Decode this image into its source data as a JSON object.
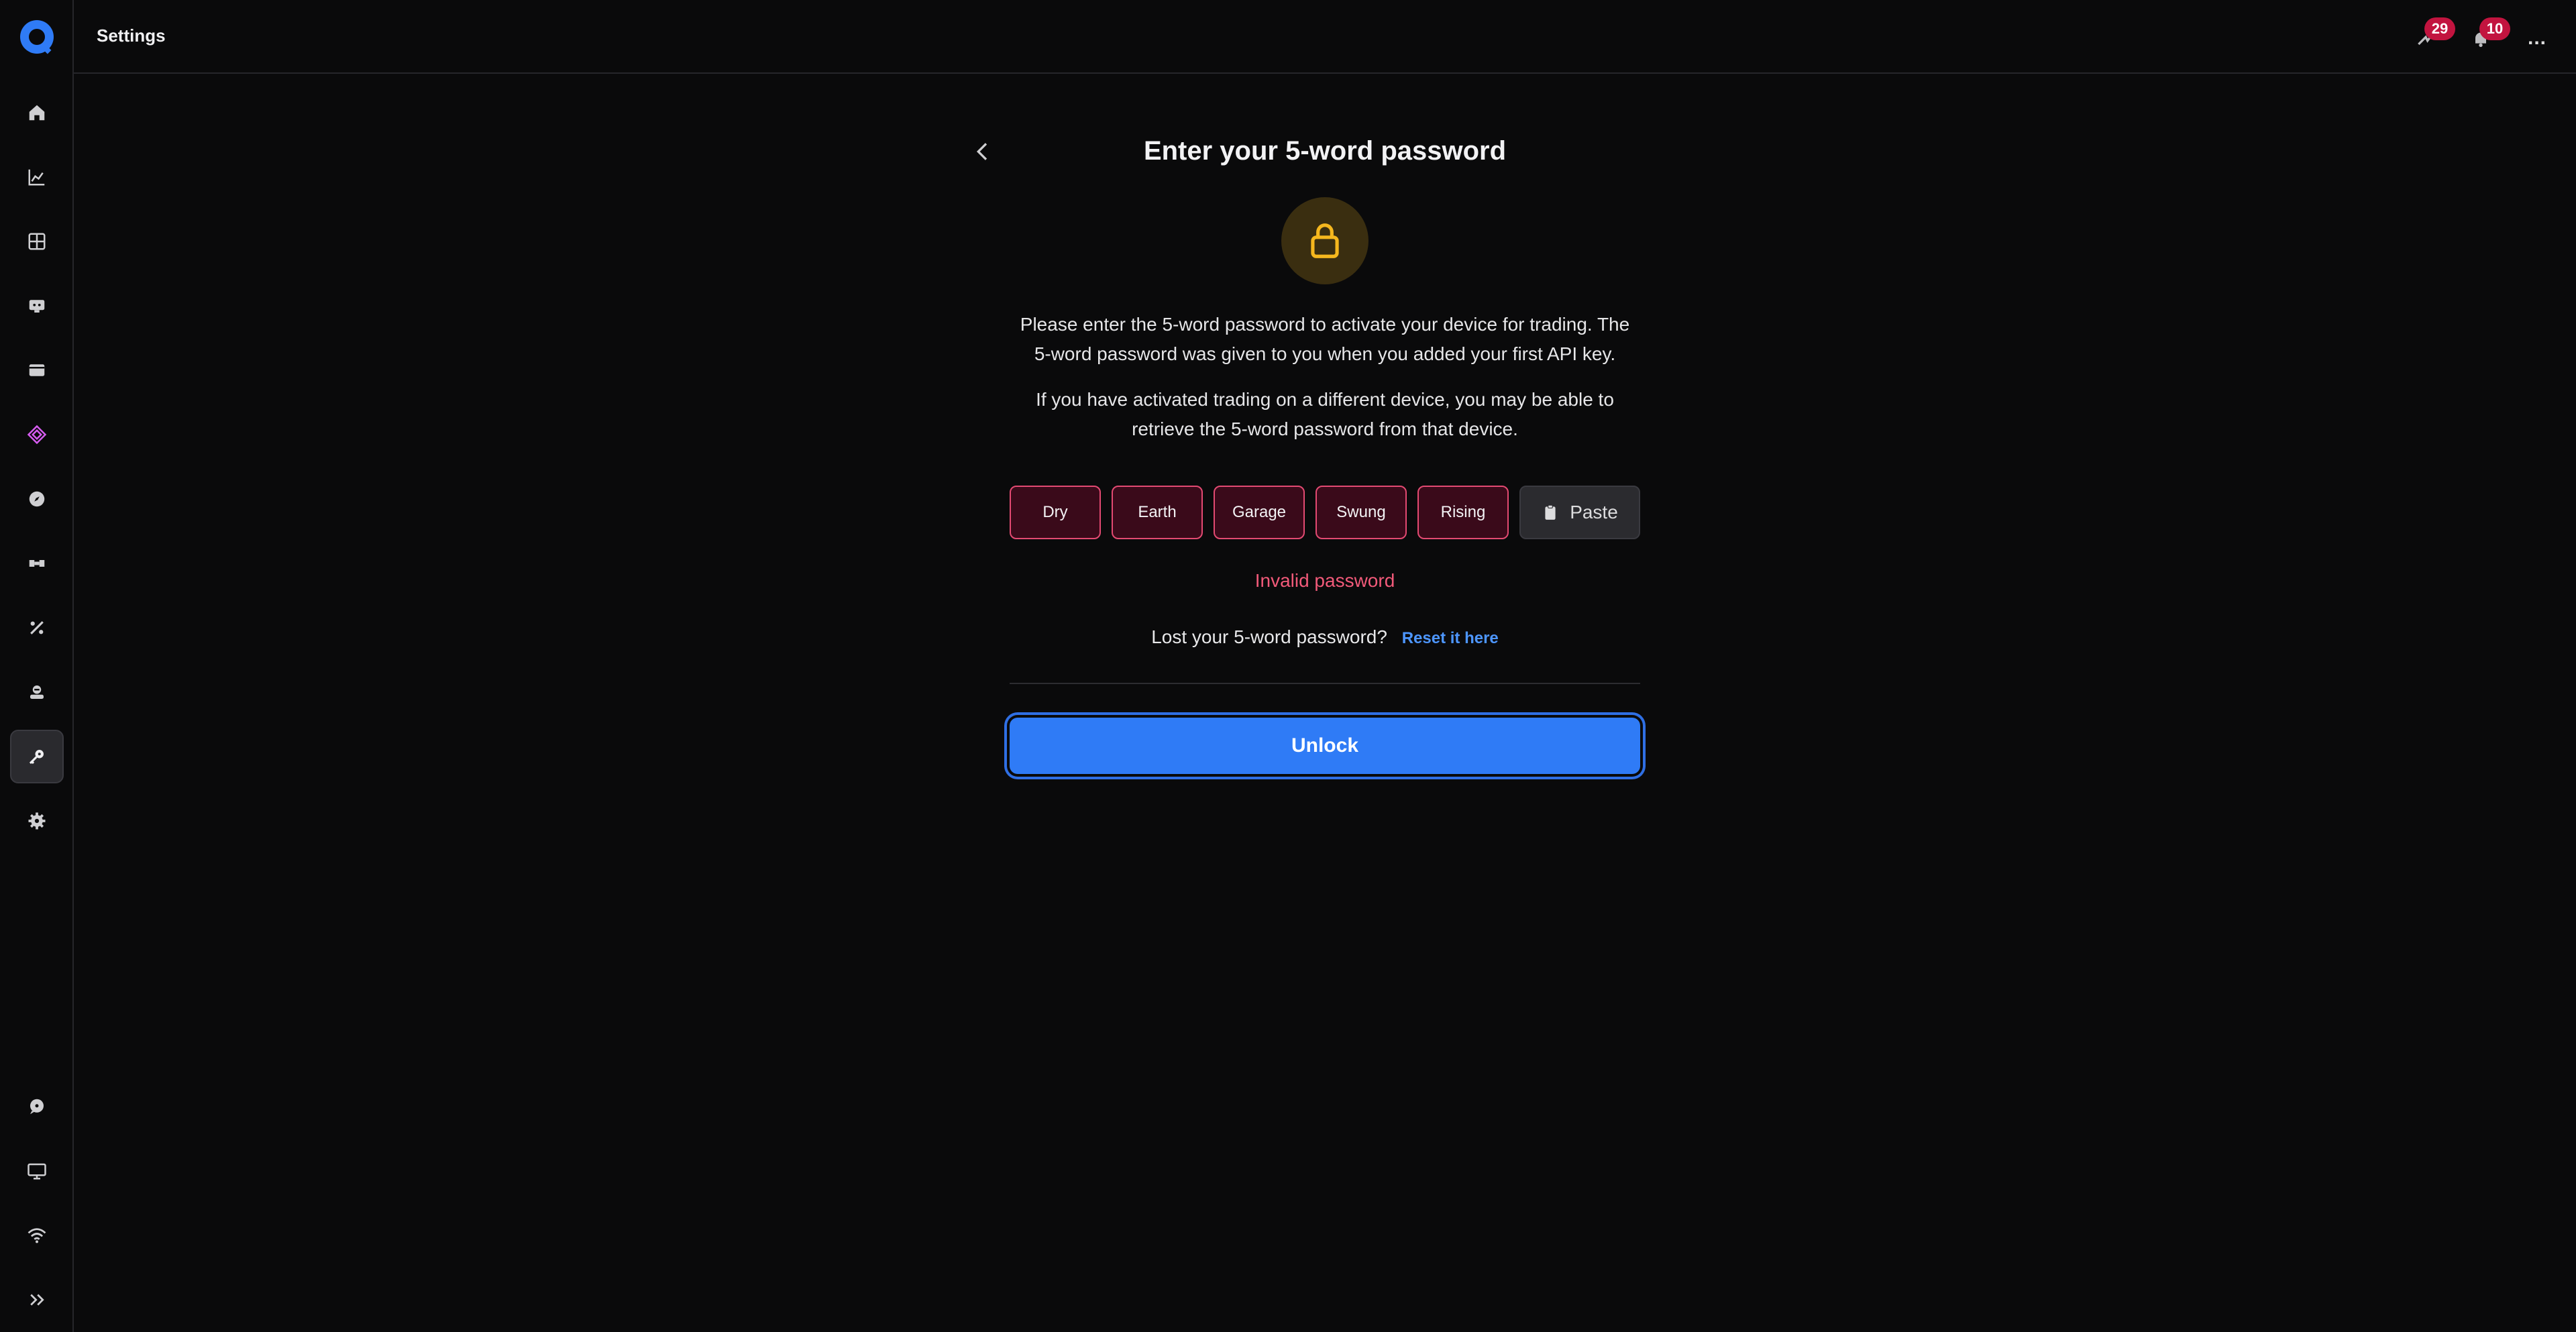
{
  "header": {
    "title": "Settings",
    "notifications_alerts_count": "29",
    "notifications_bell_count": "10",
    "more_label": "..."
  },
  "sidebar": {
    "items": [
      {
        "name": "home",
        "icon": "home-icon"
      },
      {
        "name": "charts",
        "icon": "chart-icon"
      },
      {
        "name": "dashboard",
        "icon": "grid-icon"
      },
      {
        "name": "bots",
        "icon": "bot-icon"
      },
      {
        "name": "wallet",
        "icon": "wallet-icon"
      },
      {
        "name": "premium",
        "icon": "diamond-icon"
      },
      {
        "name": "explore",
        "icon": "compass-icon"
      },
      {
        "name": "integrations",
        "icon": "puzzle-icon"
      },
      {
        "name": "fees",
        "icon": "percent-icon"
      },
      {
        "name": "account",
        "icon": "user-badge-icon"
      },
      {
        "name": "api-keys",
        "icon": "key-icon",
        "active": true
      },
      {
        "name": "settings",
        "icon": "gear-icon"
      }
    ],
    "bottom_items": [
      {
        "name": "chat",
        "icon": "chat-icon"
      },
      {
        "name": "desktop",
        "icon": "monitor-icon"
      },
      {
        "name": "connection",
        "icon": "wifi-icon"
      },
      {
        "name": "expand",
        "icon": "double-chevron-right-icon"
      }
    ]
  },
  "main": {
    "title": "Enter your 5-word password",
    "description1": "Please enter the 5-word password to activate your device for trading. The 5-word password was given to you when you added your first API key.",
    "description2": "If you have activated trading on a different device, you may be able to retrieve the 5-word password from that device.",
    "words": [
      "Dry",
      "Earth",
      "Garage",
      "Swung",
      "Rising"
    ],
    "paste_label": "Paste",
    "error_message": "Invalid password",
    "lost_text": "Lost your 5-word password?",
    "reset_link": "Reset it here",
    "unlock_label": "Unlock"
  },
  "colors": {
    "accent": "#2f7bf6",
    "error": "#f25a7a",
    "lock": "#f5b71e",
    "badge": "#c2143f"
  }
}
